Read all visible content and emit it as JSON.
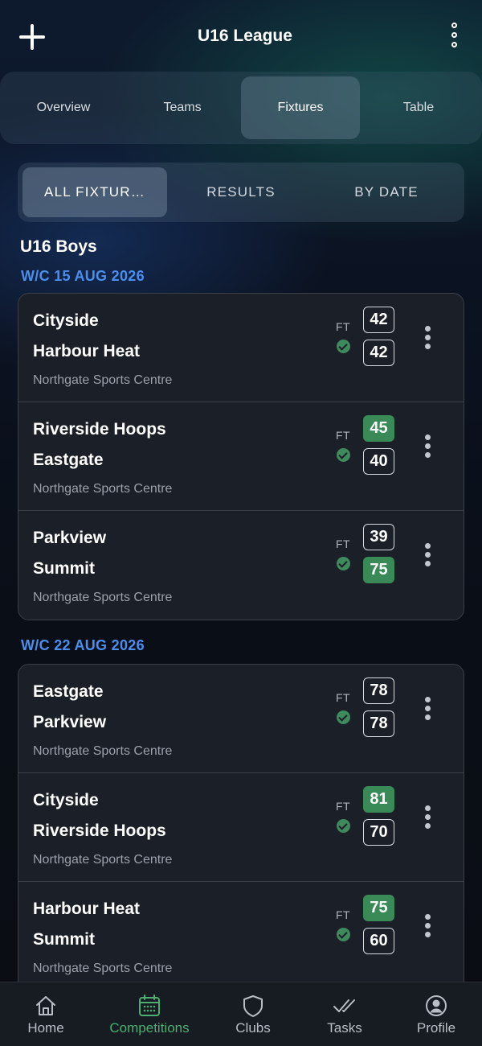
{
  "header": {
    "title": "U16 League"
  },
  "main_tabs": [
    {
      "label": "Overview",
      "active": false
    },
    {
      "label": "Teams",
      "active": false
    },
    {
      "label": "Fixtures",
      "active": true
    },
    {
      "label": "Table",
      "active": false
    }
  ],
  "sub_tabs": [
    {
      "label": "ALL FIXTUR…",
      "active": true
    },
    {
      "label": "RESULTS",
      "active": false
    },
    {
      "label": "BY DATE",
      "active": false
    }
  ],
  "section_title": "U16 Boys",
  "weeks": [
    {
      "label": "W/C 15 AUG 2026",
      "fixtures": [
        {
          "home": "Cityside",
          "away": "Harbour Heat",
          "venue": "Northgate Sports Centre",
          "status": "FT",
          "home_score": "42",
          "away_score": "42",
          "winner": "none"
        },
        {
          "home": "Riverside Hoops",
          "away": "Eastgate",
          "venue": "Northgate Sports Centre",
          "status": "FT",
          "home_score": "45",
          "away_score": "40",
          "winner": "home"
        },
        {
          "home": "Parkview",
          "away": "Summit",
          "venue": "Northgate Sports Centre",
          "status": "FT",
          "home_score": "39",
          "away_score": "75",
          "winner": "away"
        }
      ]
    },
    {
      "label": "W/C 22 AUG 2026",
      "fixtures": [
        {
          "home": "Eastgate",
          "away": "Parkview",
          "venue": "Northgate Sports Centre",
          "status": "FT",
          "home_score": "78",
          "away_score": "78",
          "winner": "none"
        },
        {
          "home": "Cityside",
          "away": "Riverside Hoops",
          "venue": "Northgate Sports Centre",
          "status": "FT",
          "home_score": "81",
          "away_score": "70",
          "winner": "home"
        },
        {
          "home": "Harbour Heat",
          "away": "Summit",
          "venue": "Northgate Sports Centre",
          "status": "FT",
          "home_score": "75",
          "away_score": "60",
          "winner": "home"
        }
      ]
    }
  ],
  "bottom_nav": [
    {
      "label": "Home",
      "icon": "home-icon",
      "active": false
    },
    {
      "label": "Competitions",
      "icon": "calendar-icon",
      "active": true
    },
    {
      "label": "Clubs",
      "icon": "shield-icon",
      "active": false
    },
    {
      "label": "Tasks",
      "icon": "double-check-icon",
      "active": false
    },
    {
      "label": "Profile",
      "icon": "profile-icon",
      "active": false
    }
  ],
  "colors": {
    "accent_blue": "#4a8ff0",
    "win_green": "#3a8a57",
    "active_nav": "#4caf72"
  }
}
